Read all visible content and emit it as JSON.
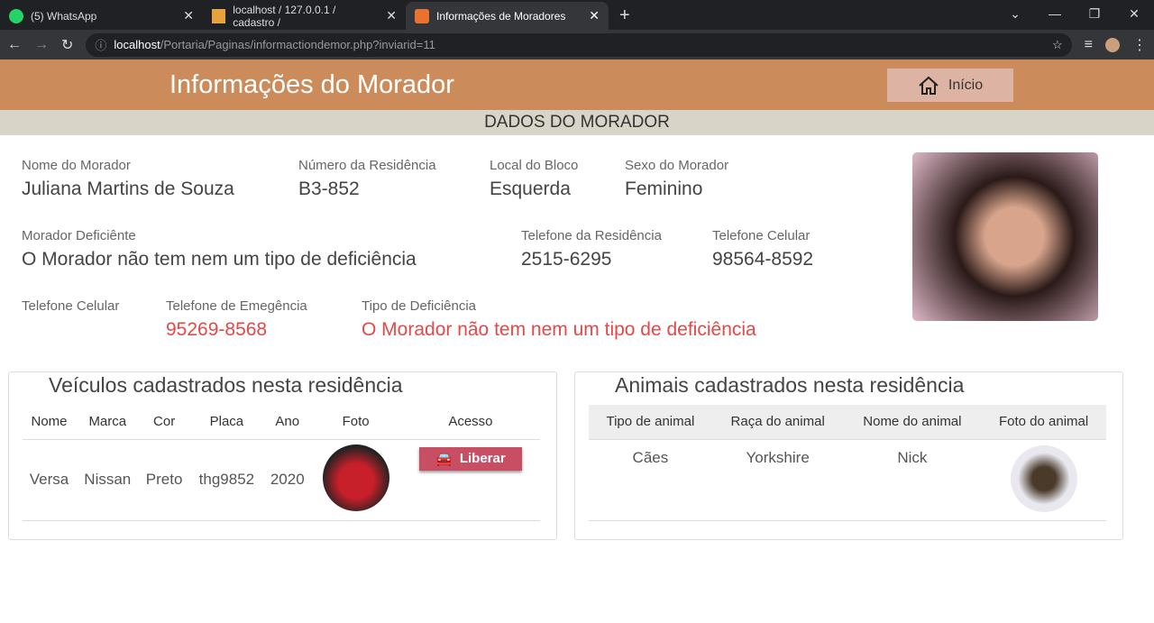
{
  "browser": {
    "tabs": [
      {
        "title": "(5) WhatsApp"
      },
      {
        "title": "localhost / 127.0.0.1 / cadastro / "
      },
      {
        "title": "Informações de Moradores"
      }
    ],
    "url_host": "localhost",
    "url_path": "/Portaria/Paginas/informactiondemor.php?inviarid=11"
  },
  "header": {
    "title": "Informações do Morador",
    "home_label": "Início"
  },
  "section_title": "DADOS DO MORADOR",
  "fields": [
    {
      "label": "Nome do Morador",
      "value": "Juliana Martins de Souza"
    },
    {
      "label": "Número da Residência",
      "value": "B3-852"
    },
    {
      "label": "Local do Bloco",
      "value": "Esquerda"
    },
    {
      "label": "Sexo do Morador",
      "value": "Feminino"
    },
    {
      "label": "Morador Deficiênte",
      "value": "O Morador não tem nem um tipo de deficiência"
    },
    {
      "label": "Telefone da Residência",
      "value": "2515-6295"
    },
    {
      "label": "Telefone Celular",
      "value": "98564-8592"
    },
    {
      "label": "Telefone Celular",
      "value": ""
    },
    {
      "label": "Telefone de Emegência",
      "value": "95269-8568"
    },
    {
      "label": "Tipo de Deficiência",
      "value": "O Morador não tem nem um tipo de deficiência"
    }
  ],
  "vehicles": {
    "title": "Veículos cadastrados nesta residência",
    "columns": [
      "Nome",
      "Marca",
      "Cor",
      "Placa",
      "Ano",
      "Foto",
      "Acesso"
    ],
    "rows": [
      [
        "Versa",
        "Nissan",
        "Preto",
        "thg9852",
        "2020"
      ]
    ],
    "action_label": "Liberar"
  },
  "animals": {
    "title": "Animais cadastrados nesta residência",
    "columns": [
      "Tipo de animal",
      "Raça do animal",
      "Nome do animal",
      "Foto do animal"
    ],
    "rows": [
      [
        "Cães",
        "Yorkshire",
        "Nick"
      ]
    ]
  }
}
